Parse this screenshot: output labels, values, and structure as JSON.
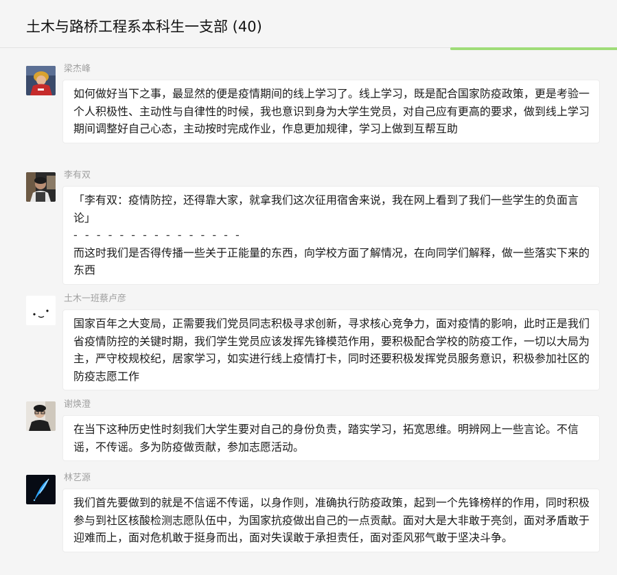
{
  "window": {
    "title": "土木与路桥工程系本科生一支部 (40)"
  },
  "load_progress": 0.27,
  "colors": {
    "background": "#f5f5f5",
    "bubble": "#ffffff",
    "progress": "#9fdc78",
    "name_text": "#a0a0a0"
  },
  "messages": [
    {
      "sender": "梁杰峰",
      "avatar": "person-red-hoodie-avatar",
      "text": "如何做好当下之事，最显然的便是疫情期间的线上学习了。线上学习，既是配合国家防疫政策，更是考验一个人积极性、主动性与自律性的时候，我也意识到身为大学生党员，对自己应有更高的要求，做到线上学习期间调整好自己心态，主动按时完成作业，作息更加规律，学习上做到互帮互助"
    },
    {
      "sender": "李有双",
      "avatar": "person-dark-photo-avatar",
      "quote": "「李有双：疫情防控，还得靠大家，就拿我们这次征用宿舍来说，我在网上看到了我们一些学生的负面言论」",
      "divider": "- - - - - - - - - - - - - - -",
      "text": "而这时我们是否得传播一些关于正能量的东西，向学校方面了解情况，在向同学们解释，做一些落实下来的东西"
    },
    {
      "sender": "土木一班蔡卢彦",
      "avatar": "smiley-face-avatar",
      "text": "国家百年之大变局，正需要我们党员同志积极寻求创新，寻求核心竞争力，面对疫情的影响，此时正是我们省疫情防控的关键时期，我们学生党员应该发挥先锋模范作用，要积极配合学校的防疫工作，一切以大局为主，严守校规校纪，居家学习，如实进行线上疫情打卡，同时还要积极发挥党员服务意识，积极参加社区的防疫志愿工作"
    },
    {
      "sender": "谢焕澄",
      "avatar": "person-portrait-avatar",
      "text": "在当下这种历史性时刻我们大学生要对自己的身份负责，踏实学习，拓宽思维。明辨网上一些言论。不信谣，不传谣。多为防疫做贡献，参加志愿活动。"
    },
    {
      "sender": "林艺源",
      "avatar": "blue-feather-avatar",
      "text": "我们首先要做到的就是不信谣不传谣，以身作则，准确执行防疫政策，起到一个先锋榜样的作用，同时积极参与到社区核酸检测志愿队伍中，为国家抗疫做出自己的一点贡献。面对大是大非敢于亮剑，面对矛盾敢于迎难而上，面对危机敢于挺身而出，面对失误敢于承担责任，面对歪风邪气敢于坚决斗争。"
    }
  ]
}
